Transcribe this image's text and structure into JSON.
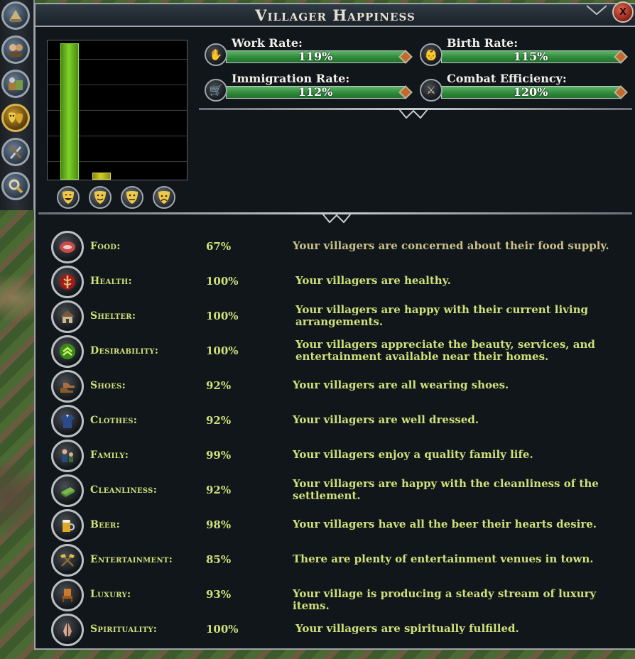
{
  "window": {
    "title": "Villager Happiness",
    "close_label": "X"
  },
  "rail": {
    "items": [
      {
        "name": "city-icon",
        "active": false
      },
      {
        "name": "villagers-icon",
        "active": false
      },
      {
        "name": "goods-icon",
        "active": false
      },
      {
        "name": "happiness-masks-icon",
        "active": true
      },
      {
        "name": "military-icon",
        "active": false
      },
      {
        "name": "magnify-icon",
        "active": false
      }
    ]
  },
  "chart_data": {
    "type": "bar",
    "categories": [
      "very happy",
      "happy",
      "unhappy",
      "very unhappy"
    ],
    "values": [
      100,
      4,
      0,
      0
    ],
    "ylim": [
      0,
      100
    ],
    "grid": true,
    "colors": [
      "#7fd22a",
      "#cfcf2a",
      "#cfcf2a",
      "#cfcf2a"
    ],
    "icons": [
      "very-happy-mask-icon",
      "happy-mask-icon",
      "neutral-mask-icon",
      "sad-mask-icon"
    ]
  },
  "stats": {
    "work_rate": {
      "label": "Work Rate:",
      "value": "119%",
      "icon": "work-hand-icon"
    },
    "birth_rate": {
      "label": "Birth Rate:",
      "value": "115%",
      "icon": "baby-icon"
    },
    "immigration_rate": {
      "label": "Immigration Rate:",
      "value": "112%",
      "icon": "wagon-icon"
    },
    "combat_efficiency": {
      "label": "Combat Efficiency:",
      "value": "120%",
      "icon": "sword-icon"
    }
  },
  "factors": [
    {
      "name": "Food:",
      "value": "67%",
      "desc": "Your villagers are concerned about their food supply.",
      "icon": "meat-icon"
    },
    {
      "name": "Health:",
      "value": "100%",
      "desc": "Your villagers are healthy.",
      "icon": "caduceus-icon"
    },
    {
      "name": "Shelter:",
      "value": "100%",
      "desc": "Your villagers are happy with their current living arrangements.",
      "icon": "house-icon"
    },
    {
      "name": "Desirability:",
      "value": "100%",
      "desc": "Your villagers appreciate the beauty, services, and entertainment available near their homes.",
      "icon": "chevron-up-icon"
    },
    {
      "name": "Shoes:",
      "value": "92%",
      "desc": "Your villagers are all wearing shoes.",
      "icon": "shoes-icon"
    },
    {
      "name": "Clothes:",
      "value": "92%",
      "desc": "Your villagers are well dressed.",
      "icon": "clothes-icon"
    },
    {
      "name": "Family:",
      "value": "99%",
      "desc": "Your villagers enjoy a quality family life.",
      "icon": "family-icon"
    },
    {
      "name": "Cleanliness:",
      "value": "92%",
      "desc": "Your villagers are happy with the cleanliness of the settlement.",
      "icon": "soap-icon"
    },
    {
      "name": "Beer:",
      "value": "98%",
      "desc": "Your villagers have all the beer their hearts desire.",
      "icon": "beer-mug-icon"
    },
    {
      "name": "Entertainment:",
      "value": "85%",
      "desc": "There are plenty of entertainment venues in town.",
      "icon": "crossed-hammers-icon"
    },
    {
      "name": "Luxury:",
      "value": "93%",
      "desc": "Your village is producing a steady stream of luxury items.",
      "icon": "chair-icon"
    },
    {
      "name": "Spirituality:",
      "value": "100%",
      "desc": "Your villagers are spiritually fulfilled.",
      "icon": "praying-hands-icon"
    }
  ]
}
